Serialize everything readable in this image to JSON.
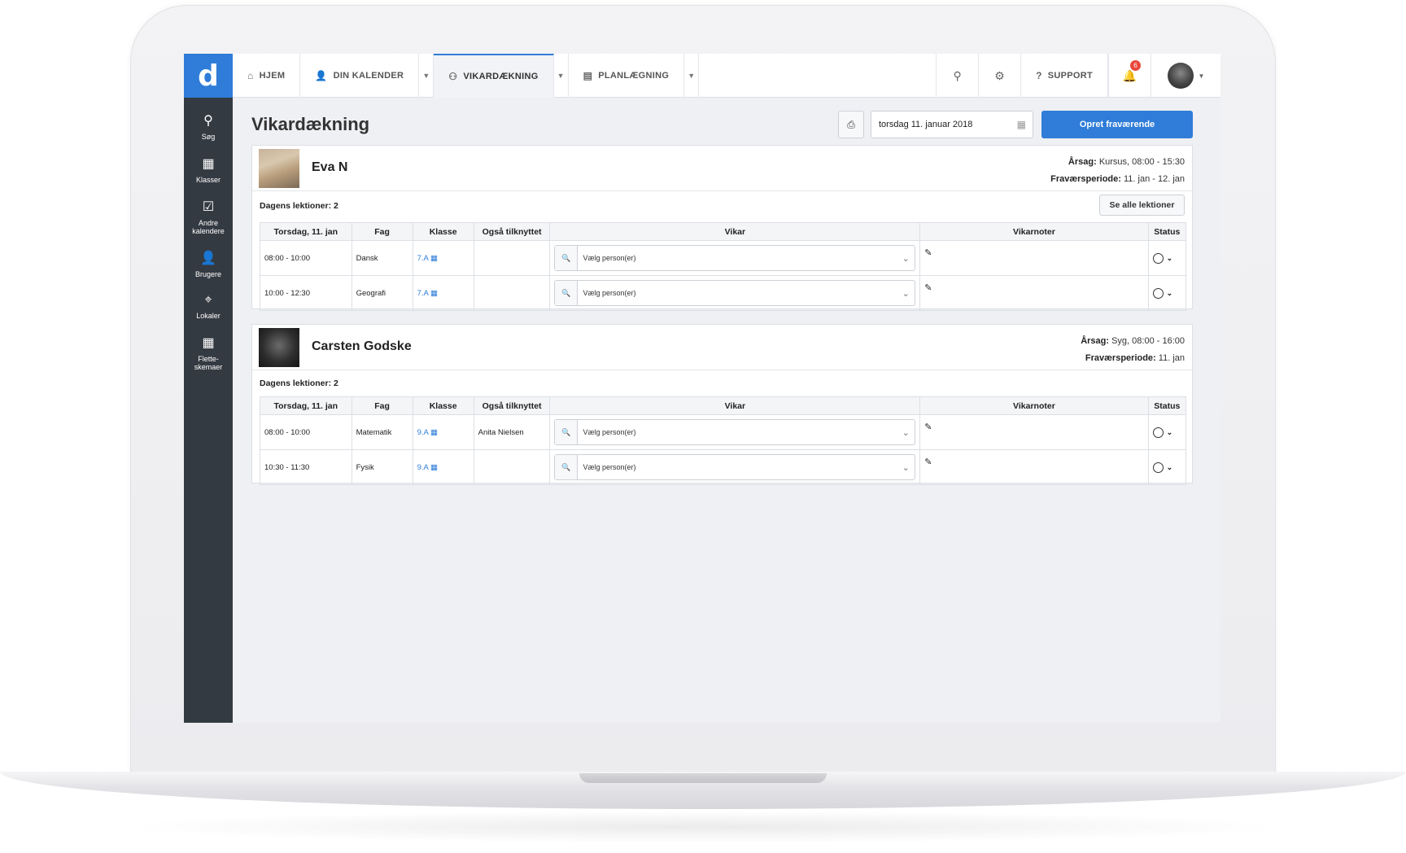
{
  "nav": {
    "logo": "d",
    "items": [
      {
        "label": "HJEM",
        "icon": "⌂"
      },
      {
        "label": "DIN KALENDER",
        "icon": "👤"
      },
      {
        "label": "VIKARDÆKNING",
        "icon": "⚇"
      },
      {
        "label": "PLANLÆGNING",
        "icon": "▤"
      }
    ],
    "support_label": "SUPPORT",
    "notification_count": "6"
  },
  "sidebar": {
    "items": [
      {
        "label": "Søg",
        "icon": "⚲"
      },
      {
        "label": "Klasser",
        "icon": "▦"
      },
      {
        "label": "Andre kalendere",
        "icon": "☑"
      },
      {
        "label": "Brugere",
        "icon": "👤"
      },
      {
        "label": "Lokaler",
        "icon": "⌖"
      },
      {
        "label": "Flette-skemaer",
        "icon": "▦"
      }
    ]
  },
  "page": {
    "title": "Vikardækning",
    "date_value": "torsdag 11. januar 2018",
    "create_button": "Opret fraværende",
    "see_all_button": "Se alle lektioner"
  },
  "table_headers": {
    "date": "Torsdag, 11. jan",
    "fag": "Fag",
    "klasse": "Klasse",
    "tilknyttet": "Også tilknyttet",
    "vikar": "Vikar",
    "vikarnoter": "Vikarnoter",
    "status": "Status"
  },
  "vikar_placeholder": "Vælg person(er)",
  "labels": {
    "reason": "Årsag:",
    "period": "Fraværsperiode:"
  },
  "absences": [
    {
      "name": "Eva N",
      "reason": "Kursus, 08:00 - 15:30",
      "period": "11. jan - 12. jan",
      "lessons_count": "Dagens lektioner: 2",
      "lessons": [
        {
          "time": "08:00 - 10:00",
          "fag": "Dansk",
          "klasse": "7.A",
          "tilknyttet": ""
        },
        {
          "time": "10:00 - 12:30",
          "fag": "Geografi",
          "klasse": "7.A",
          "tilknyttet": ""
        }
      ]
    },
    {
      "name": "Carsten Godske",
      "reason": "Syg, 08:00 - 16:00",
      "period": "11. jan",
      "lessons_count": "Dagens lektioner: 2",
      "lessons": [
        {
          "time": "08:00 - 10:00",
          "fag": "Matematik",
          "klasse": "9.A",
          "tilknyttet": "Anita Nielsen"
        },
        {
          "time": "10:30 - 11:30",
          "fag": "Fysik",
          "klasse": "9.A",
          "tilknyttet": ""
        }
      ]
    }
  ]
}
